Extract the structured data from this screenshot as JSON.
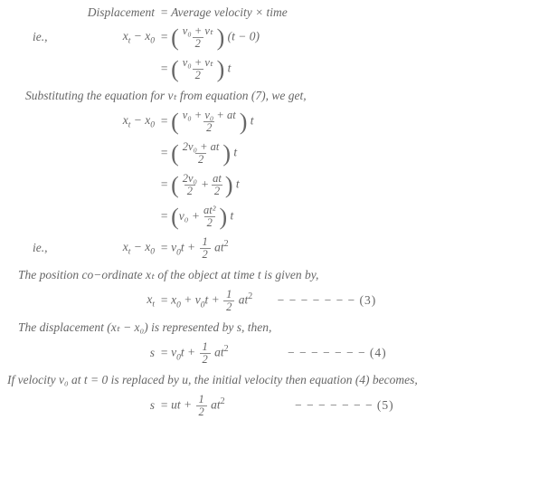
{
  "l1": {
    "lhs": "Displacement",
    "eq": "=",
    "rhs": "Average velocity × time"
  },
  "l2": {
    "ie": "ie.,",
    "lhs_a": "x",
    "lhs_asub": "t",
    "lhs_minus": " − ",
    "lhs_b": "x",
    "lhs_bsub": "0",
    "eq": "=",
    "frac_num": "v₀ + vₜ",
    "frac_den": "2",
    "tail": " (t − 0)"
  },
  "l3": {
    "eq": "=",
    "frac_num": "v₀ + vₜ",
    "frac_den": "2",
    "tail": " t"
  },
  "n1": "Substituting the equation for vₜ from equation (7),  we get,",
  "l4": {
    "lhs_a": "x",
    "lhs_asub": "t",
    "lhs_minus": " − ",
    "lhs_b": "x",
    "lhs_bsub": "0",
    "eq": "=",
    "frac_num": "v₀ + v₀ + at",
    "frac_den": "2",
    "tail": " t"
  },
  "l5": {
    "eq": "=",
    "frac_num": "2v₀ + at",
    "frac_den": "2",
    "tail": " t"
  },
  "l6": {
    "eq": "=",
    "f1_num": "2v₀",
    "f1_den": "2",
    "plus": " + ",
    "f2_num": "at",
    "f2_den": "2",
    "tail": " t"
  },
  "l7": {
    "eq": "=",
    "pre": "v₀ + ",
    "f_num": "at²",
    "f_den": "2",
    "tail": " t"
  },
  "l8": {
    "ie": "ie.,",
    "lhs_a": "x",
    "lhs_asub": "t",
    "lhs_minus": " − ",
    "lhs_b": "x",
    "lhs_bsub": "0",
    "eq": "=",
    "t1": "  v",
    "t1s": "0",
    "t2": "t + ",
    "f_num": "1",
    "f_den": "2",
    "t3": "at",
    "t3s": "2"
  },
  "n2": "The position co−ordinate xₜ of the object at time t is given by,",
  "l9": {
    "lhs": "x",
    "lhs_sub": "t",
    "eq": "=",
    "t1": "x",
    "t1s": "0",
    "t2": " + v",
    "t2s": "0",
    "t3": "t + ",
    "f_num": "1",
    "f_den": "2",
    "t4": "at",
    "t4s": "2",
    "dash": "  − − − − − − − (3)"
  },
  "n3": "The displacement (xₜ − x₀) is represented by s, then,",
  "l10": {
    "lhs": "s",
    "eq": "=",
    "t1": "v",
    "t1s": "0",
    "t2": "t + ",
    "f_num": "1",
    "f_den": "2",
    "t3": "at",
    "t3s": "2",
    "dash": " − − − − − − − (4)"
  },
  "n4": "If velocity v₀ at t = 0 is replaced by u, the initial velocity then equation (4) becomes,",
  "l11": {
    "lhs": "s",
    "eq": "=",
    "t1": "ut + ",
    "f_num": "1",
    "f_den": "2",
    "t2": "at",
    "t2s": "2",
    "dash": "  − − − − − − − (5)"
  }
}
